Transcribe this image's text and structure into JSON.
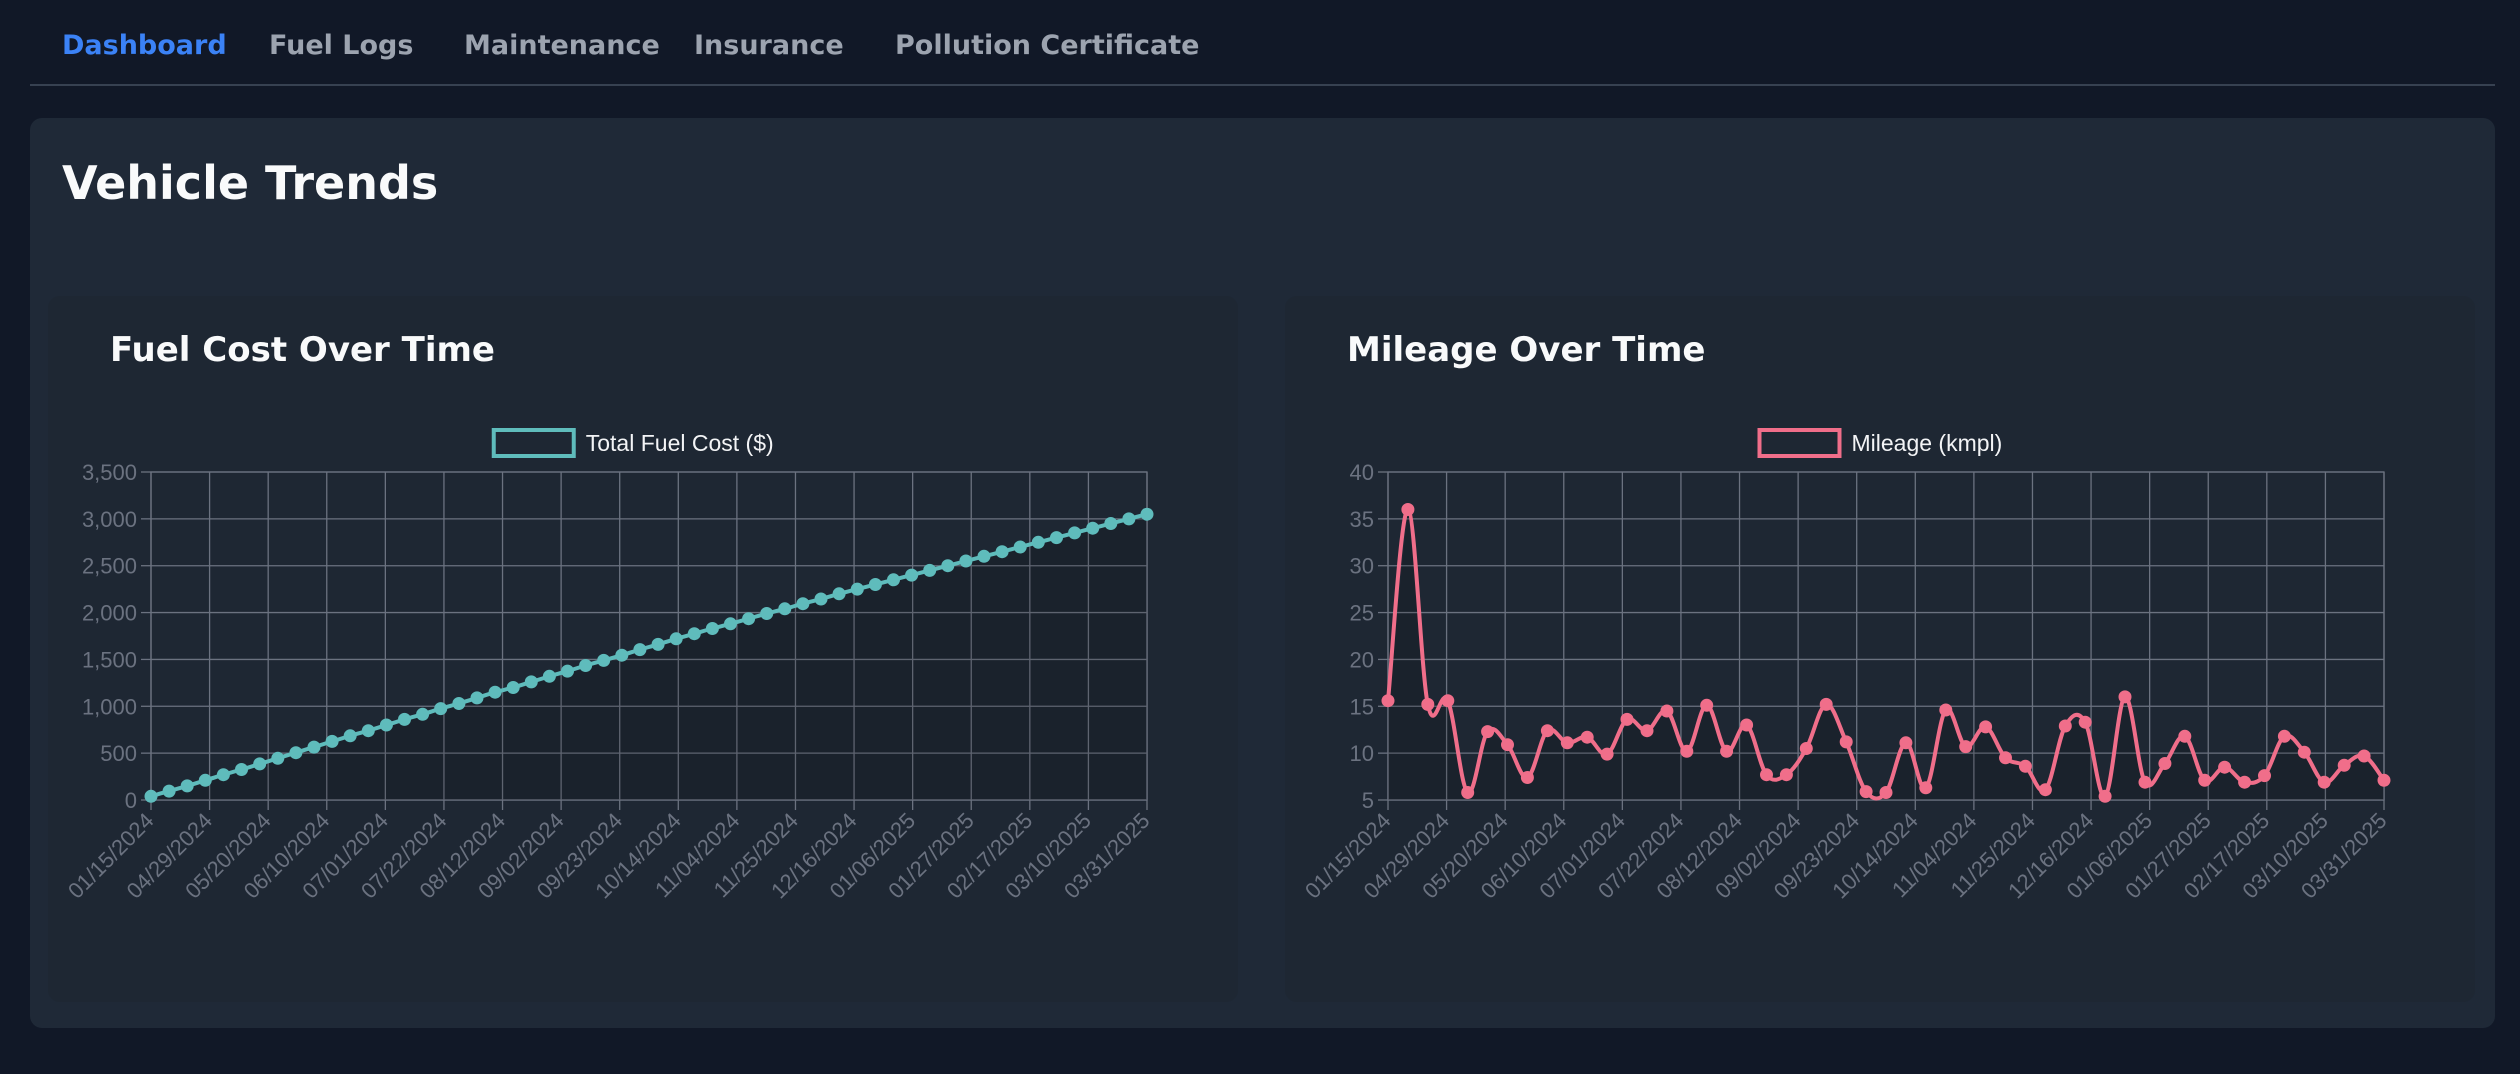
{
  "nav": {
    "tabs": [
      {
        "label": "Dashboard",
        "active": true
      },
      {
        "label": "Fuel Logs",
        "active": false
      },
      {
        "label": "Maintenance",
        "active": false
      },
      {
        "label": "Insurance",
        "active": false
      },
      {
        "label": "Pollution Certificate",
        "active": false
      }
    ]
  },
  "page": {
    "title": "Vehicle Trends"
  },
  "colors": {
    "background": "#111827",
    "panel": "#1f2937",
    "accent": "#3b82f6",
    "fuel_line": "#5fbcbc",
    "mileage_line": "#f06e8a",
    "grid": "#6b7280"
  },
  "chart_data": [
    {
      "type": "line",
      "title": "Fuel Cost Over Time",
      "xlabel": "",
      "ylabel": "",
      "ylim": [
        0,
        3500
      ],
      "yticks": [
        "0",
        "500",
        "1,000",
        "1,500",
        "2,000",
        "2,500",
        "3,000",
        "3,500"
      ],
      "x_tick_labels": [
        "01/15/2024",
        "04/29/2024",
        "05/20/2024",
        "06/10/2024",
        "07/01/2024",
        "07/22/2024",
        "08/12/2024",
        "09/02/2024",
        "09/23/2024",
        "10/14/2024",
        "11/04/2024",
        "11/25/2024",
        "12/16/2024",
        "01/06/2025",
        "01/27/2025",
        "02/17/2025",
        "03/10/2025",
        "03/31/2025"
      ],
      "grid": true,
      "legend_position": "top",
      "series": [
        {
          "name": "Total Fuel Cost ($)",
          "color": "#5fbcbc",
          "values": [
            40,
            95,
            150,
            210,
            270,
            325,
            385,
            445,
            505,
            565,
            625,
            685,
            740,
            800,
            860,
            915,
            975,
            1030,
            1090,
            1150,
            1200,
            1260,
            1320,
            1375,
            1435,
            1490,
            1545,
            1605,
            1660,
            1720,
            1775,
            1830,
            1880,
            1935,
            1990,
            2040,
            2095,
            2145,
            2200,
            2250,
            2300,
            2350,
            2400,
            2450,
            2500,
            2550,
            2600,
            2650,
            2700,
            2750,
            2800,
            2850,
            2900,
            2950,
            3000,
            3050
          ]
        }
      ]
    },
    {
      "type": "line",
      "title": "Mileage Over Time",
      "xlabel": "",
      "ylabel": "",
      "ylim": [
        5,
        40
      ],
      "yticks": [
        "5",
        "10",
        "15",
        "20",
        "25",
        "30",
        "35",
        "40"
      ],
      "x_tick_labels": [
        "01/15/2024",
        "04/29/2024",
        "05/20/2024",
        "06/10/2024",
        "07/01/2024",
        "07/22/2024",
        "08/12/2024",
        "09/02/2024",
        "09/23/2024",
        "10/14/2024",
        "11/04/2024",
        "11/25/2024",
        "12/16/2024",
        "01/06/2025",
        "01/27/2025",
        "02/17/2025",
        "03/10/2025",
        "03/31/2025"
      ],
      "grid": true,
      "legend_position": "top",
      "series": [
        {
          "name": "Mileage (kmpl)",
          "color": "#f06e8a",
          "values": [
            15.6,
            36,
            15.2,
            15.6,
            5.8,
            12.3,
            10.9,
            7.4,
            12.4,
            11.1,
            11.7,
            9.9,
            13.6,
            12.4,
            14.5,
            10.2,
            15.1,
            10.2,
            13.0,
            7.7,
            7.7,
            10.5,
            15.2,
            11.2,
            5.9,
            5.8,
            11.1,
            6.3,
            14.6,
            10.7,
            12.8,
            9.5,
            8.6,
            6.1,
            12.9,
            13.3,
            5.4,
            16.0,
            6.9,
            8.9,
            11.8,
            7.1,
            8.5,
            6.9,
            7.6,
            11.8,
            10.1,
            6.9,
            8.7,
            9.7,
            7.1
          ]
        }
      ]
    }
  ]
}
